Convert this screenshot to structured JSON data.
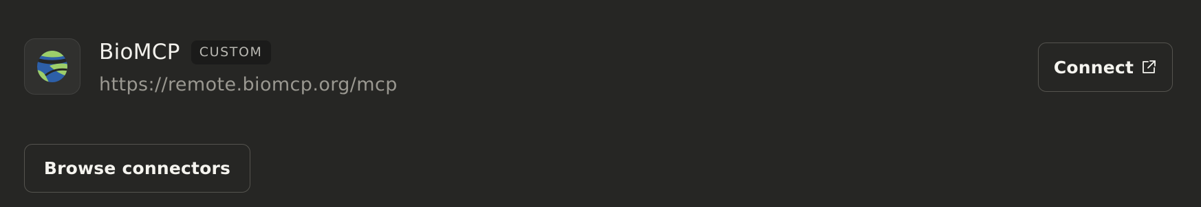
{
  "connector": {
    "name": "BioMCP",
    "badge": "CUSTOM",
    "url": "https://remote.biomcp.org/mcp",
    "logo_icon": "biomcp-globe-logo",
    "logo_colors": {
      "green": "#9dce6a",
      "blue": "#2d5fa8"
    }
  },
  "actions": {
    "connect_label": "Connect",
    "connect_icon": "external-link-icon",
    "browse_label": "Browse connectors"
  },
  "colors": {
    "background": "#262624",
    "text_primary": "#f5f4ef",
    "text_secondary": "#9a9891",
    "button_border": "#55544f"
  }
}
